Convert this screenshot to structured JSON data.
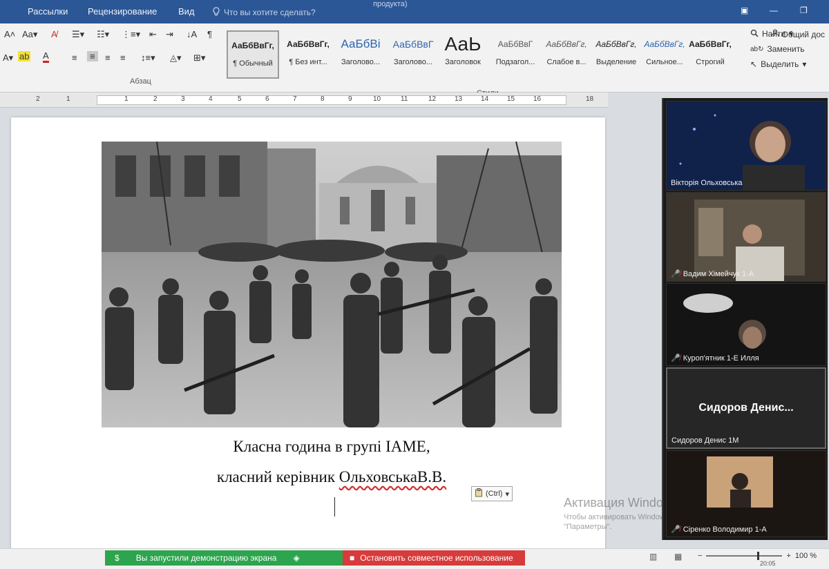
{
  "menubar": {
    "tabs": [
      "Рассылки",
      "Рецензирование",
      "Вид"
    ],
    "tell_me": "Что вы хотите сделать?",
    "title_fragment": "продукта)"
  },
  "ribbon": {
    "share_label": "Общий дос",
    "groups": {
      "paragraph": "Абзац",
      "styles": "Стили"
    },
    "font_size_label": "Aa",
    "styles": [
      {
        "sample": "АаБбВвГг,",
        "name": "¶ Обычный"
      },
      {
        "sample": "АаБбВвГг,",
        "name": "¶ Без инт..."
      },
      {
        "sample": "АаБбВі",
        "name": "Заголово..."
      },
      {
        "sample": "АаБбВвГ",
        "name": "Заголово..."
      },
      {
        "sample": "АаЬ",
        "name": "Заголовок"
      },
      {
        "sample": "АаБбВвГ",
        "name": "Подзагол..."
      },
      {
        "sample": "АаБбВвГг,",
        "name": "Слабое в..."
      },
      {
        "sample": "АаБбВвГг,",
        "name": "Выделение"
      },
      {
        "sample": "АаБбВвГг,",
        "name": "Сильное..."
      },
      {
        "sample": "АаБбВвГг,",
        "name": "Строгий"
      }
    ],
    "editing": {
      "find": "Найти",
      "replace": "Заменить",
      "select": "Выделить"
    }
  },
  "ruler": {
    "numbers": [
      "2",
      "1",
      "1",
      "2",
      "3",
      "4",
      "5",
      "6",
      "7",
      "8",
      "9",
      "10",
      "11",
      "12",
      "13",
      "14",
      "15",
      "16",
      "18"
    ]
  },
  "document": {
    "caption_line1": "Класна  година  в групі ІАМЕ,",
    "caption_line2_prefix": "класний керівник ",
    "caption_line2_name": "ОльховськаВ.В.",
    "paste_options": "(Ctrl)"
  },
  "activation": {
    "title": "Активация Windows",
    "line1": "Чтобы активировать Windows, перейдите в раздел",
    "line2": "\"Параметры\"."
  },
  "zoom": {
    "participants": [
      {
        "name": "Вікторія Ольховська",
        "muted": false
      },
      {
        "name": "Вадим Хімейчук 1-А",
        "muted": true
      },
      {
        "name": "Куроп'ятник 1-Е Илля",
        "muted": true
      },
      {
        "name": "Сидоров Денис 1М",
        "display": "Сидоров Денис...",
        "muted": false
      },
      {
        "name": "Сіренко Володимир 1-А",
        "muted": true
      }
    ]
  },
  "statusbar": {
    "share_label": "Вы запустили демонстрацию экрана",
    "stop_label": "Остановить совместное использование",
    "zoom_level": "100 %",
    "time": "20:05"
  }
}
